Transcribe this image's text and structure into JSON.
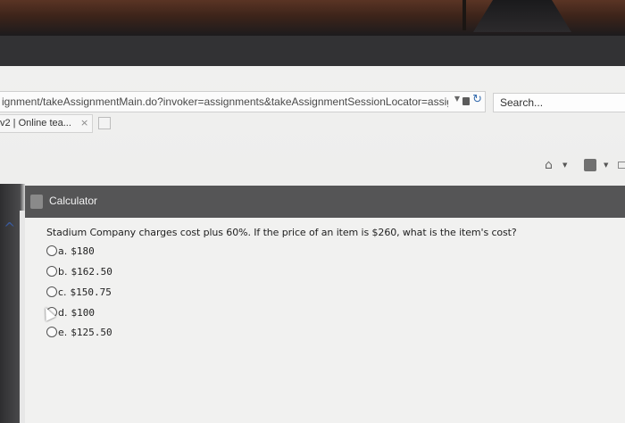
{
  "browser": {
    "url": "ignment/takeAssignmentMain.do?invoker=assignments&takeAssignmentSessionLocator=assigni",
    "search_placeholder": "Search...",
    "tab": {
      "title": "v2 | Online tea...",
      "close": "×"
    }
  },
  "calculator": {
    "label": "Calculator"
  },
  "question": {
    "text": "Stadium Company charges cost plus 60%. If the price of an item is $260, what is the item's cost?",
    "options": [
      {
        "letter": "a.",
        "value": "$180"
      },
      {
        "letter": "b.",
        "value": "$162.50"
      },
      {
        "letter": "c.",
        "value": "$150.75"
      },
      {
        "letter": "d.",
        "value": "$100"
      },
      {
        "letter": "e.",
        "value": "$125.50"
      }
    ]
  },
  "icons": [
    "dropdown-arrow-icon",
    "lock-icon",
    "refresh-icon",
    "home-icon",
    "rss-icon",
    "mail-icon",
    "calculator-icon",
    "collapse-caret-icon",
    "mouse-cursor-icon"
  ]
}
